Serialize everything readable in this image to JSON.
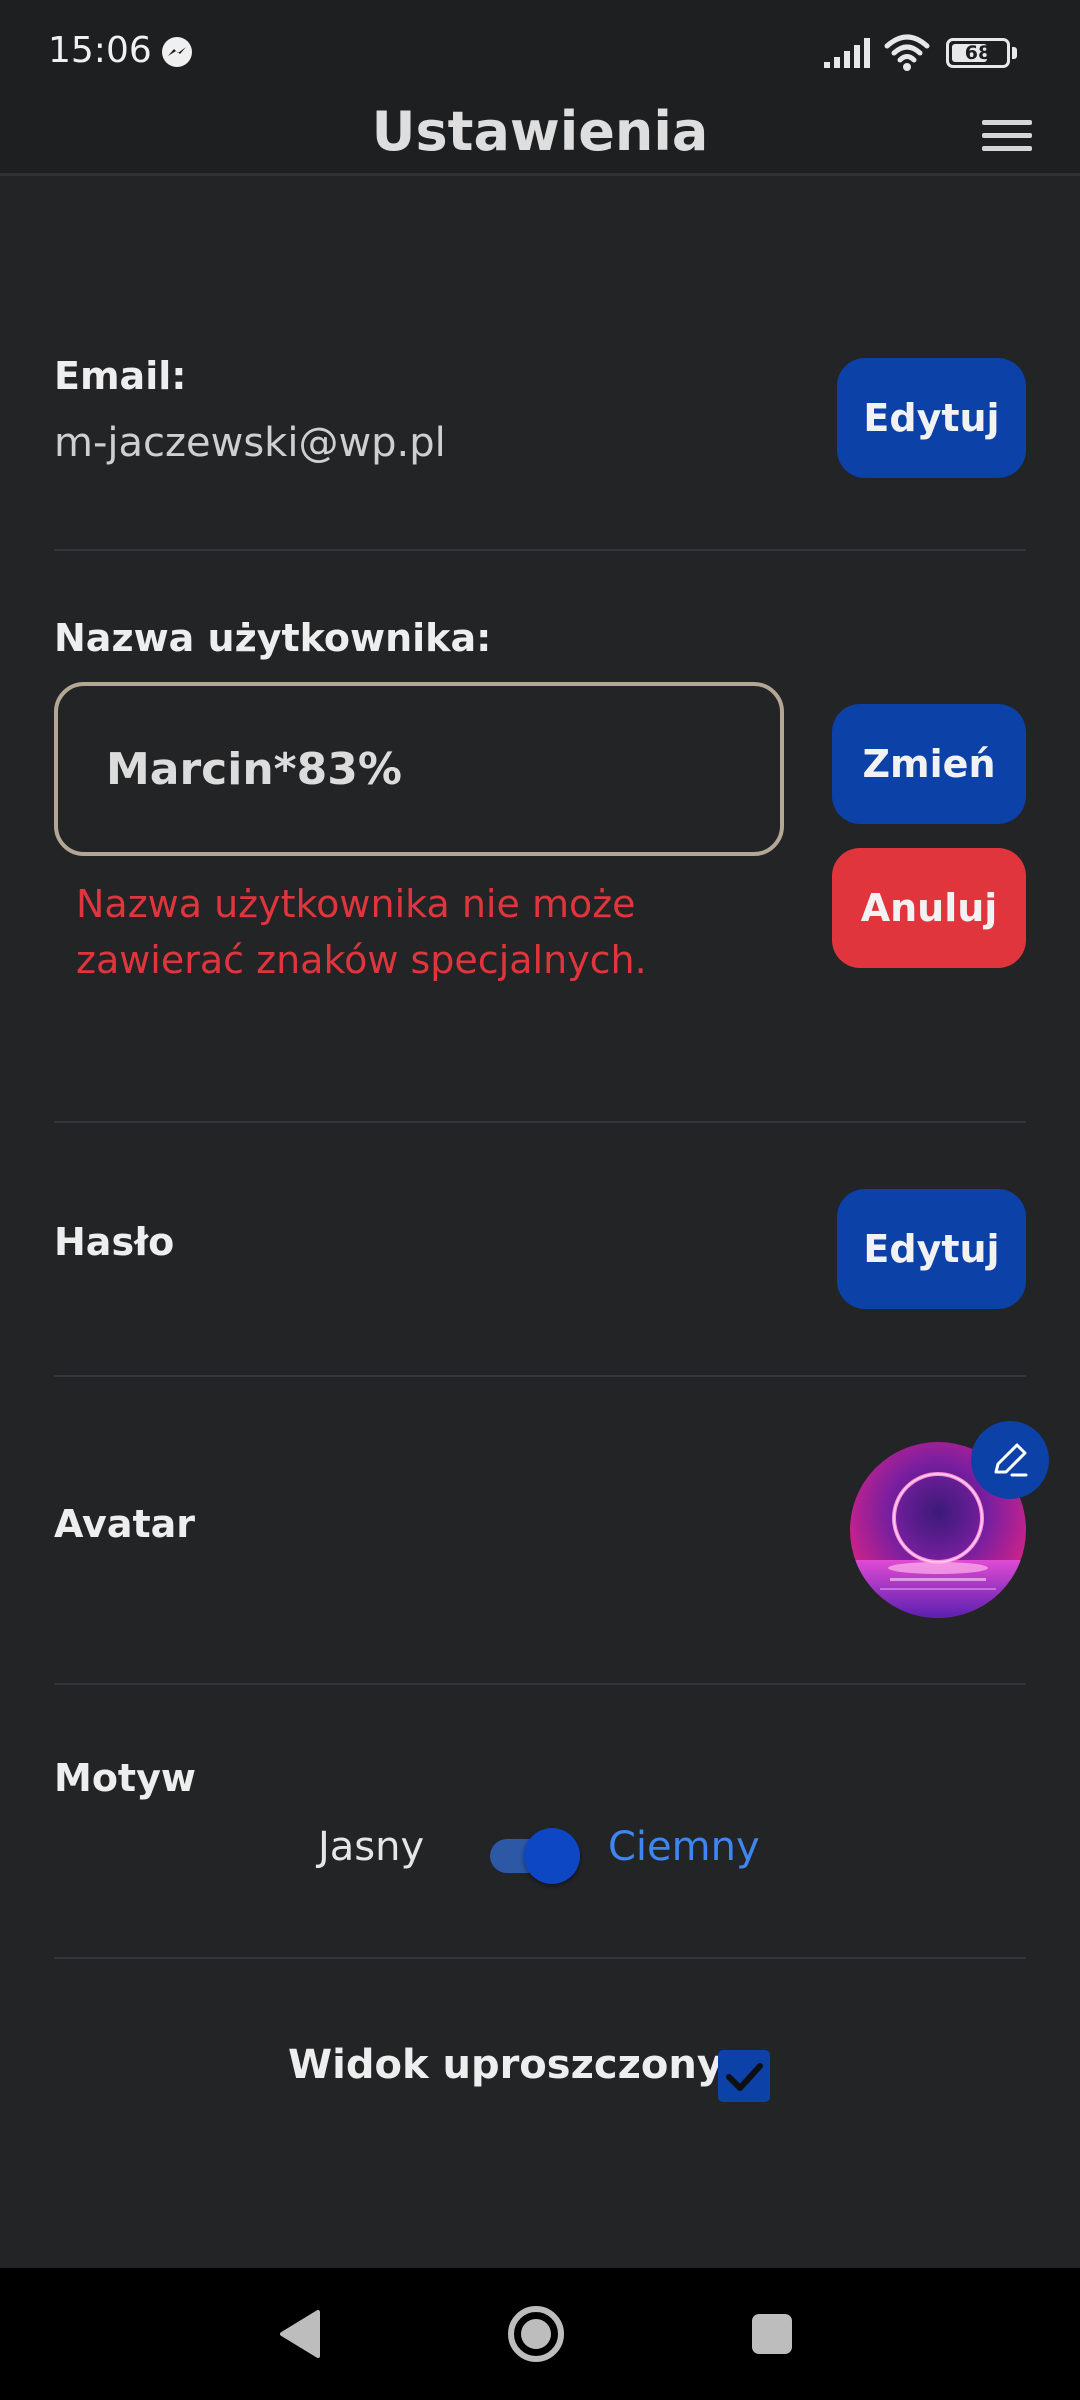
{
  "status_bar": {
    "time": "15:06",
    "battery": "68",
    "battery_level": 0.68,
    "icons": [
      "messenger-icon",
      "signal-icon",
      "wifi-icon",
      "battery-icon"
    ]
  },
  "header": {
    "title": "Ustawienia",
    "menu_icon": "hamburger-menu-icon"
  },
  "email": {
    "label": "Email:",
    "value": "m-jaczewski@wp.pl",
    "edit_label": "Edytuj"
  },
  "username": {
    "label": "Nazwa użytkownika:",
    "input_value": "Marcin*83%",
    "change_label": "Zmień",
    "cancel_label": "Anuluj",
    "error": "Nazwa użytkownika nie może zawierać znaków specjalnych."
  },
  "password": {
    "label": "Hasło",
    "edit_label": "Edytuj"
  },
  "avatar": {
    "label": "Avatar",
    "edit_icon": "pencil-icon"
  },
  "theme": {
    "label": "Motyw",
    "light_label": "Jasny",
    "dark_label": "Ciemny",
    "selected": "Ciemny"
  },
  "simplified_view": {
    "label": "Widok uproszczony",
    "checked": true
  },
  "nav_bar": {
    "icons": [
      "back-icon",
      "home-icon",
      "recent-apps-icon"
    ]
  },
  "colors": {
    "background": "#222426",
    "bar": "#1d1f21",
    "primary_button": "#0c41a8",
    "danger": "#e0353d",
    "accent_text": "#3f86f1",
    "input_border": "#b5a795"
  }
}
